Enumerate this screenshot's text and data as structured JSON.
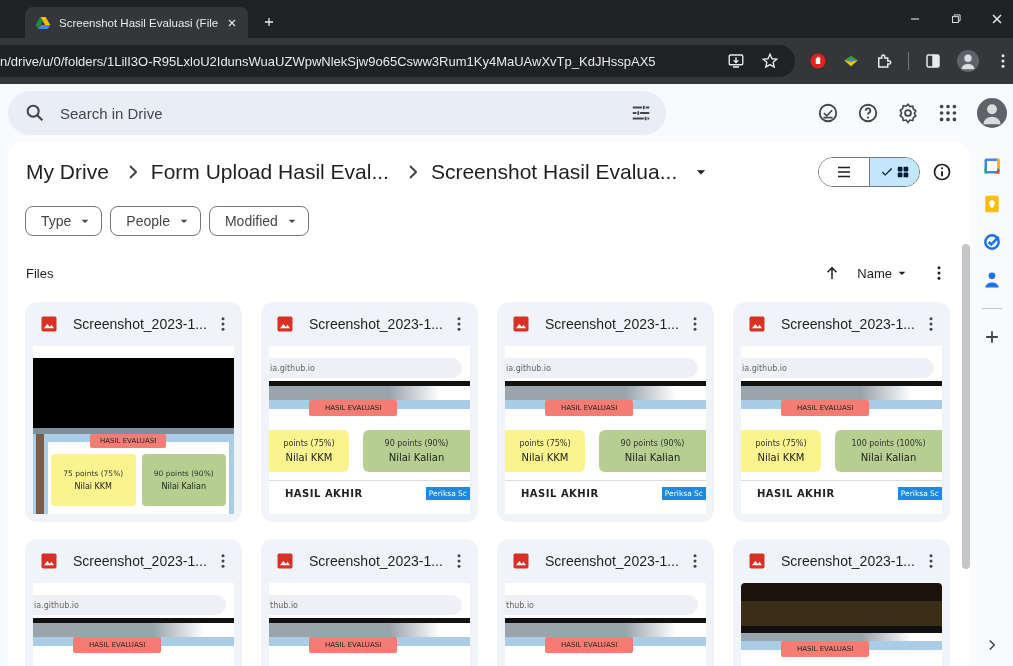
{
  "browser": {
    "tab": {
      "title": "Screenshot Hasil Evaluasi (File",
      "selected": true
    },
    "address": "n/drive/u/0/folders/1LilI3O-R95LxloU2IdunsWuaUZWpwNlekSjw9o65Csww3Rum1Ky4MaUAwXvTp_KdJHsspAX5"
  },
  "search": {
    "placeholder": "Search in Drive"
  },
  "breadcrumbs": [
    "My Drive",
    "Form Upload Hasil Eval...",
    "Screenshot Hasil Evalua..."
  ],
  "view_toggle": [
    {
      "kind": "list",
      "selected": false
    },
    {
      "kind": "grid",
      "selected": true
    }
  ],
  "filters": [
    "Type",
    "People",
    "Modified"
  ],
  "section_title": "Files",
  "sort": {
    "label": "Name"
  },
  "files": [
    {
      "name": "Screenshot_2023-1...",
      "thumbnail": {
        "kind": "video",
        "banner": "HASIL EVALUASI",
        "kkm_score": "75 points (75%)",
        "kkm_label": "Nilai KKM",
        "your_score": "90 points (90%)",
        "your_label": "Nilai Kalian"
      }
    },
    {
      "name": "Screenshot_2023-1...",
      "thumbnail": {
        "kind": "webpage",
        "url": "ia.github.io",
        "banner": "HASIL EVALUASI",
        "kkm_score": "points (75%)",
        "kkm_label": "Nilai KKM",
        "your_score": "90 points (90%)",
        "your_label": "Nilai Kalian",
        "heading": "HASIL AKHIR",
        "button": "Periksa Sc"
      }
    },
    {
      "name": "Screenshot_2023-1...",
      "thumbnail": {
        "kind": "webpage",
        "url": "ia.github.io",
        "banner": "HASIL EVALUASI",
        "kkm_score": "points (75%)",
        "kkm_label": "Nilai KKM",
        "your_score": "90 points (90%)",
        "your_label": "Nilai Kalian",
        "heading": "HASIL AKHIR",
        "button": "Periksa Sc"
      }
    },
    {
      "name": "Screenshot_2023-1...",
      "thumbnail": {
        "kind": "webpage",
        "url": "ia.github.io",
        "banner": "HASIL EVALUASI",
        "kkm_score": "points (75%)",
        "kkm_label": "Nilai KKM",
        "your_score": "100 points (100%)",
        "your_label": "Nilai Kalian",
        "heading": "HASIL AKHIR",
        "button": "Periksa Sc"
      }
    },
    {
      "name": "Screenshot_2023-1...",
      "thumbnail": {
        "kind": "webpage",
        "url": "ia.github.io",
        "banner": "HASIL EVALUASI"
      }
    },
    {
      "name": "Screenshot_2023-1...",
      "thumbnail": {
        "kind": "webpage",
        "url": "thub.io",
        "banner": "HASIL EVALUASI"
      }
    },
    {
      "name": "Screenshot_2023-1...",
      "thumbnail": {
        "kind": "webpage",
        "url": "thub.io",
        "banner": "HASIL EVALUASI"
      }
    },
    {
      "name": "Screenshot_2023-1...",
      "thumbnail": {
        "kind": "dark",
        "banner": "HASIL EVALUASI"
      }
    }
  ]
}
